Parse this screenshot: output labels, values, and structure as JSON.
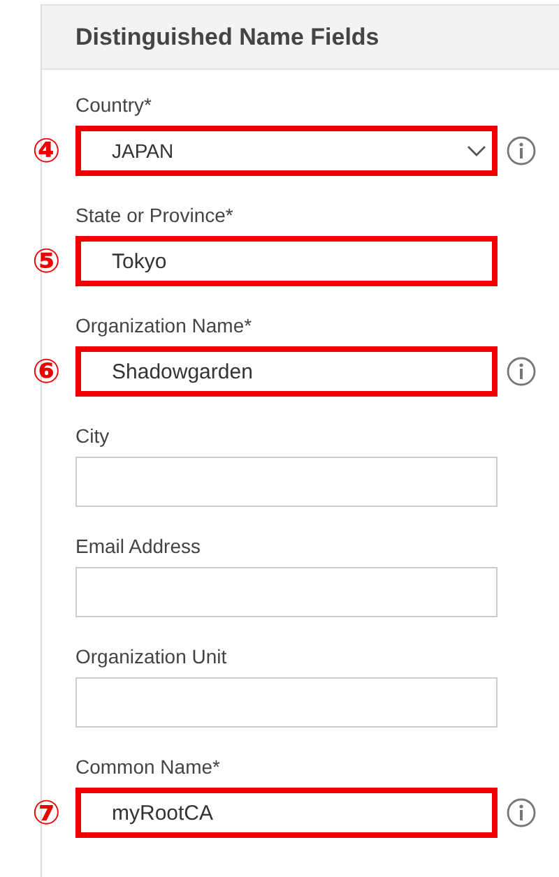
{
  "panel": {
    "title": "Distinguished Name Fields"
  },
  "fields": [
    {
      "kind": "select",
      "label": "Country*",
      "value": "JAPAN",
      "highlighted": true,
      "marker": "④",
      "info": true
    },
    {
      "kind": "text",
      "label": "State or Province*",
      "value": "Tokyo",
      "highlighted": true,
      "marker": "⑤",
      "info": false
    },
    {
      "kind": "text",
      "label": "Organization Name*",
      "value": "Shadowgarden",
      "highlighted": true,
      "marker": "⑥",
      "info": true
    },
    {
      "kind": "text",
      "label": "City",
      "highlighted": false,
      "info": false
    },
    {
      "kind": "text",
      "label": "Email Address",
      "highlighted": false,
      "info": false
    },
    {
      "kind": "text",
      "label": "Organization Unit",
      "highlighted": false,
      "info": false
    },
    {
      "kind": "text",
      "label": "Common Name*",
      "value": "myRootCA",
      "highlighted": true,
      "marker": "⑦",
      "info": true
    }
  ]
}
